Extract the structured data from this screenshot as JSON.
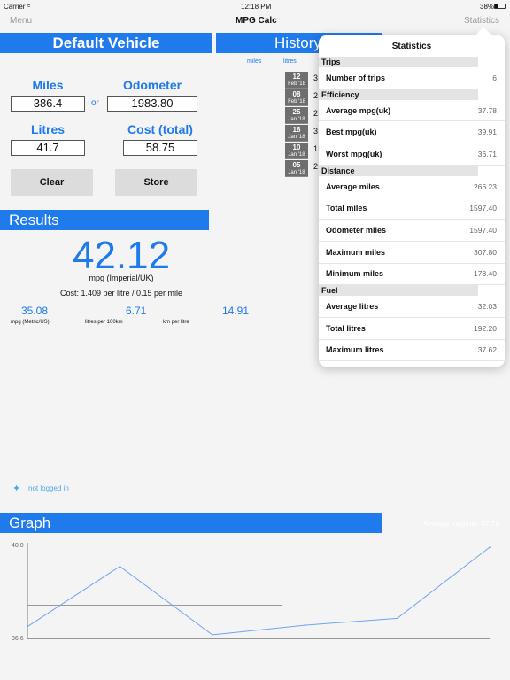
{
  "status": {
    "carrier": "Carrier",
    "time": "12:18 PM",
    "battery": "38%"
  },
  "nav": {
    "menu": "Menu",
    "title": "MPG Calc",
    "statistics": "Statistics"
  },
  "vehicle": "Default Vehicle",
  "inputs": {
    "miles_label": "Miles",
    "miles": "386.4",
    "or": "or",
    "odometer_label": "Odometer",
    "odometer": "1983.80",
    "litres_label": "Litres",
    "litres": "41.7",
    "cost_label": "Cost (total)",
    "cost": "58.75"
  },
  "buttons": {
    "clear": "Clear",
    "store": "Store"
  },
  "results": {
    "title": "Results",
    "mpg": "42.12",
    "mpg_unit": "mpg (Imperial/UK)",
    "cost": "Cost: 1.409 per litre / 0.15 per mile",
    "metrics": [
      {
        "value": "35.08",
        "label": "mpg (Metric/US)"
      },
      {
        "value": "6.71",
        "label": "litres per 100km"
      },
      {
        "value": "14.91",
        "label": "km per litre"
      }
    ]
  },
  "twitter": "not logged in",
  "history": {
    "title": "History",
    "col_miles": "miles",
    "col_litres": "litres",
    "items": [
      {
        "day": "12",
        "month": "Feb '18",
        "v": "3"
      },
      {
        "day": "08",
        "month": "Feb '18",
        "v": "2"
      },
      {
        "day": "25",
        "month": "Jan '18",
        "v": "2"
      },
      {
        "day": "18",
        "month": "Jan '18",
        "v": "3"
      },
      {
        "day": "10",
        "month": "Jan '18",
        "v": "1"
      },
      {
        "day": "05",
        "month": "Jan '18",
        "v": "2"
      }
    ]
  },
  "popover": {
    "title": "Statistics",
    "sections": [
      {
        "name": "Trips",
        "rows": [
          {
            "label": "Number of trips",
            "value": "6"
          }
        ]
      },
      {
        "name": "Efficiency",
        "rows": [
          {
            "label": "Average mpg(uk)",
            "value": "37.78"
          },
          {
            "label": "Best mpg(uk)",
            "value": "39.91"
          },
          {
            "label": "Worst mpg(uk)",
            "value": "36.71"
          }
        ]
      },
      {
        "name": "Distance",
        "rows": [
          {
            "label": "Average miles",
            "value": "266.23"
          },
          {
            "label": "Total miles",
            "value": "1597.40"
          },
          {
            "label": "Odometer miles",
            "value": "1597.40"
          },
          {
            "label": "Maximum miles",
            "value": "307.80"
          },
          {
            "label": "Minimum miles",
            "value": "178.40"
          }
        ]
      },
      {
        "name": "Fuel",
        "rows": [
          {
            "label": "Average litres",
            "value": "32.03"
          },
          {
            "label": "Total litres",
            "value": "192.20"
          },
          {
            "label": "Maximum litres",
            "value": "37.62"
          }
        ]
      }
    ]
  },
  "graph": {
    "title": "Graph",
    "average_label": "Average mpg(uk): 37.78"
  },
  "chart_data": {
    "type": "line",
    "ylim": [
      36.6,
      40.0
    ],
    "y_ticks": [
      "40.0",
      "36.6"
    ],
    "values": [
      37.0,
      39.2,
      36.7,
      37.05,
      37.3,
      39.9
    ],
    "average": 37.78,
    "line_color": "#6fa4f0"
  }
}
